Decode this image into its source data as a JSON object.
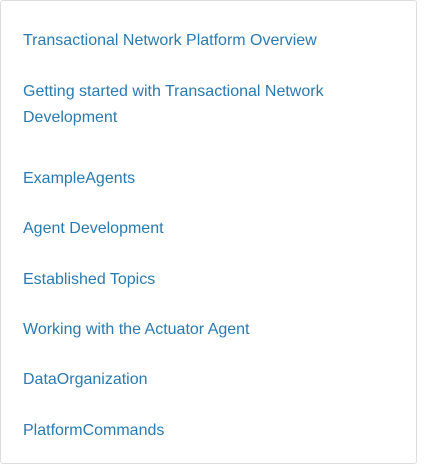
{
  "nav": {
    "items": [
      {
        "label": "Transactional Network Platform Overview"
      },
      {
        "label": "Getting started with Transactional Network Development"
      },
      {
        "label": "ExampleAgents"
      },
      {
        "label": "Agent Development"
      },
      {
        "label": "Established Topics"
      },
      {
        "label": "Working with the Actuator Agent"
      },
      {
        "label": "DataOrganization"
      },
      {
        "label": "PlatformCommands"
      }
    ],
    "link_color": "#2a7ab0",
    "border_color": "#dddddd"
  }
}
